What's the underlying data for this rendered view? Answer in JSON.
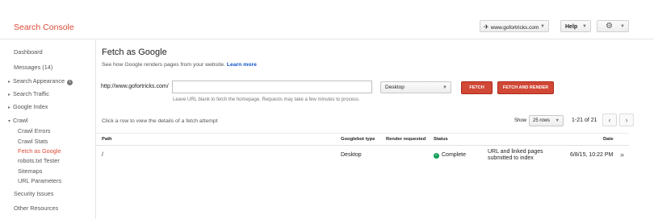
{
  "header": {
    "brand": "Search Console",
    "site": "www.gofortricks.com",
    "help_label": "Help"
  },
  "sidebar": {
    "items": [
      {
        "label": "Dashboard"
      },
      {
        "label": "Messages (14)"
      },
      {
        "label": "Search Appearance"
      },
      {
        "label": "Search Traffic"
      },
      {
        "label": "Google Index"
      },
      {
        "label": "Crawl"
      },
      {
        "label": "Crawl Errors"
      },
      {
        "label": "Crawl Stats"
      },
      {
        "label": "Fetch as Google"
      },
      {
        "label": "robots.txt Tester"
      },
      {
        "label": "Sitemaps"
      },
      {
        "label": "URL Parameters"
      },
      {
        "label": "Security Issues"
      },
      {
        "label": "Other Resources"
      }
    ]
  },
  "main": {
    "title": "Fetch as Google",
    "description": "See how Google renders pages from your website.",
    "learn_more": "Learn more",
    "url_prefix": "http://www.gofortricks.com/",
    "url_value": "",
    "url_hint": "Leave URL blank to fetch the homepage. Requests may take a few minutes to process.",
    "device": "Desktop",
    "fetch_label": "FETCH",
    "fetch_render_label": "FETCH AND RENDER",
    "click_hint": "Click a row to view the details of a fetch attempt",
    "show_label": "Show",
    "rows_option": "25 rows",
    "range": "1-21 of 21"
  },
  "table": {
    "headers": {
      "path": "Path",
      "bot": "Googlebot type",
      "render": "Render requested",
      "status": "Status",
      "date": "Date"
    },
    "rows": [
      {
        "path": "/",
        "bot": "Desktop",
        "status": "Complete",
        "note_line1": "URL and linked pages",
        "note_line2": "submitted to index",
        "date": "6/8/15, 10:22 PM"
      }
    ]
  }
}
